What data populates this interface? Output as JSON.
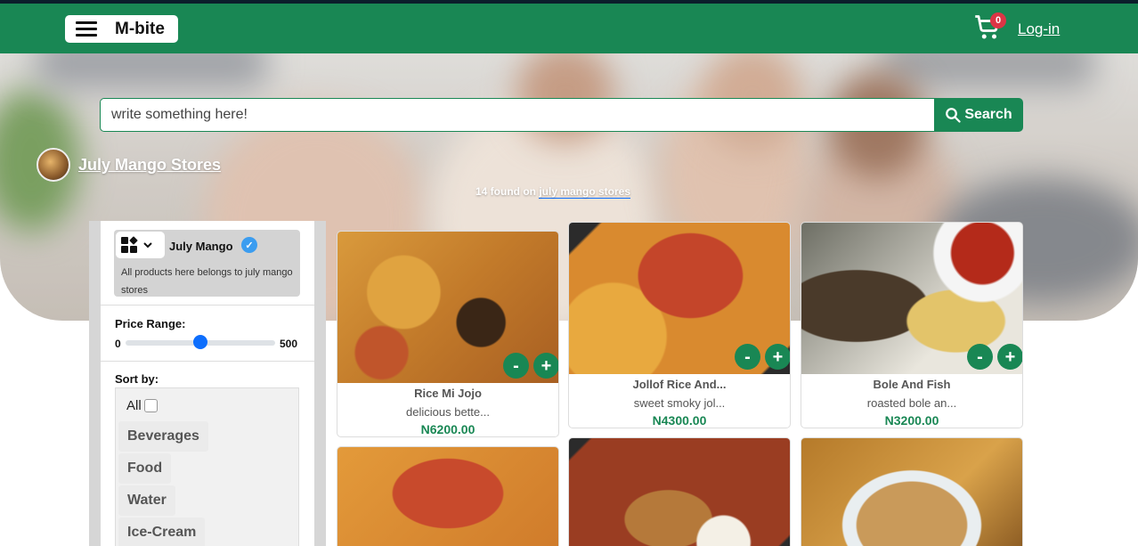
{
  "navbar": {
    "brand": "M-bite",
    "cart_count": "0",
    "login": "Log-in"
  },
  "search": {
    "placeholder": "write something here!",
    "button_label": "Search"
  },
  "store": {
    "name": "July Mango Stores",
    "found_count": "14 found on ",
    "found_link": "july mango stores"
  },
  "sidebar": {
    "store_title": "July Mango",
    "store_description": "All products here belongs to july mango stores",
    "price_range_label": "Price Range:",
    "range_min": "0",
    "range_max": "500",
    "range_value_fraction": 0.5,
    "sort_label": "Sort by:",
    "sort_all": "All",
    "categories": [
      "Beverages",
      "Food",
      "Water",
      "Ice-Cream"
    ]
  },
  "products": [
    {
      "title": "Rice Mi Jojo",
      "desc": "delicious bette...",
      "price": "N6200.00"
    },
    {
      "title": "Jollof Rice And...",
      "desc": "sweet smoky jol...",
      "price": "N4300.00"
    },
    {
      "title": "Bole And Fish",
      "desc": "roasted bole an...",
      "price": "N3200.00"
    },
    {
      "title": "",
      "desc": "",
      "price": ""
    },
    {
      "title": "",
      "desc": "",
      "price": ""
    },
    {
      "title": "",
      "desc": "",
      "price": ""
    }
  ],
  "buttons": {
    "minus": "-",
    "plus": "+"
  },
  "colors": {
    "primary": "#198754",
    "badge": "#dc3545",
    "thumb": "#0d6efd"
  }
}
